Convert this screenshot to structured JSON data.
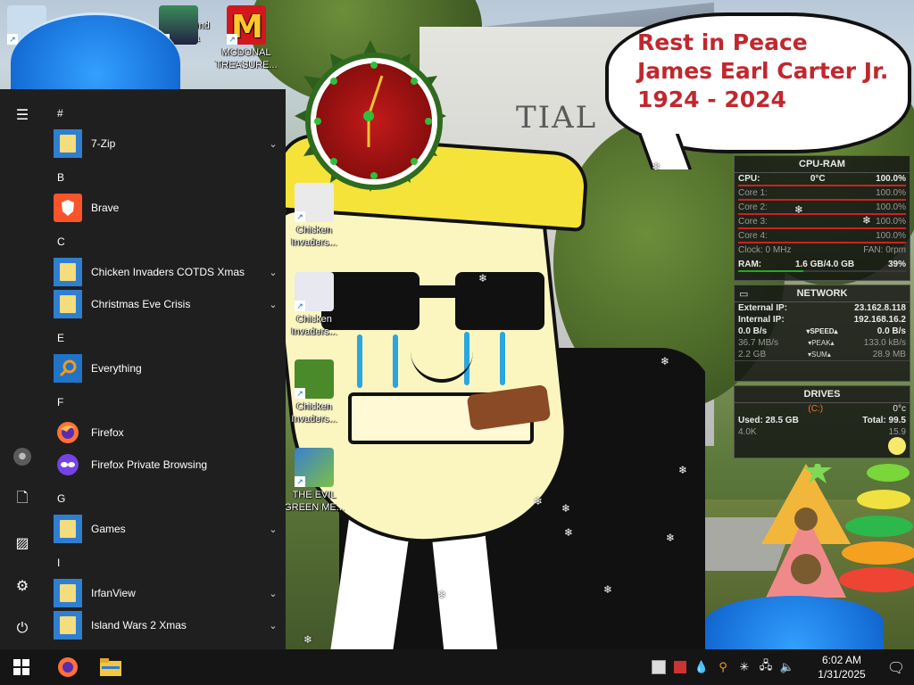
{
  "speech_bubble": {
    "line1": "Rest in Peace",
    "line2": "James Earl Carter Jr.",
    "line3": "1924 - 2024"
  },
  "wallpaper": {
    "building_text": "TIAL"
  },
  "desktop_icons": {
    "top_legend": "Legend\nilda",
    "mcdonald": "MCDONAL\nTREASURE...",
    "chicken1": "Chicken\nInvaders...",
    "chicken2": "Chicken\nInvaders...",
    "chicken3": "Chicken\nInvaders...",
    "evil": "THE EVIL\nGREEN ME..."
  },
  "start_menu": {
    "groups": [
      {
        "letter": "#",
        "items": [
          {
            "label": "7-Zip",
            "icon": "folder-icon",
            "expand": true
          }
        ]
      },
      {
        "letter": "B",
        "items": [
          {
            "label": "Brave",
            "icon": "brave-icon",
            "expand": false
          }
        ]
      },
      {
        "letter": "C",
        "items": [
          {
            "label": "Chicken Invaders COTDS Xmas",
            "icon": "folder-icon",
            "expand": true
          },
          {
            "label": "Christmas Eve Crisis",
            "icon": "folder-icon",
            "expand": true
          }
        ]
      },
      {
        "letter": "E",
        "items": [
          {
            "label": "Everything",
            "icon": "everything-icon",
            "expand": false
          }
        ]
      },
      {
        "letter": "F",
        "items": [
          {
            "label": "Firefox",
            "icon": "firefox-icon",
            "expand": false
          },
          {
            "label": "Firefox Private Browsing",
            "icon": "firefox-private-icon",
            "expand": false
          }
        ]
      },
      {
        "letter": "G",
        "items": [
          {
            "label": "Games",
            "icon": "folder-icon",
            "expand": true
          }
        ]
      },
      {
        "letter": "I",
        "items": [
          {
            "label": "IrfanView",
            "icon": "folder-icon",
            "expand": true
          },
          {
            "label": "Island Wars 2 Xmas",
            "icon": "folder-icon",
            "expand": true
          }
        ]
      }
    ],
    "chevron": "⌄",
    "rail": {
      "menu": "☰",
      "user": "●",
      "documents": "🗋",
      "pictures": "▨",
      "settings": "⚙",
      "power": "⏻"
    }
  },
  "monitor": {
    "cpu_ram": {
      "title": "CPU-RAM",
      "cpu_label": "CPU:",
      "cpu_temp": "0°C",
      "cpu_pct": "100.0%",
      "cores": [
        {
          "label": "Core 1:",
          "value": "100.0%"
        },
        {
          "label": "Core 2:",
          "value": "100.0%"
        },
        {
          "label": "Core 3:",
          "value": "100.0%"
        },
        {
          "label": "Core 4:",
          "value": "100.0%"
        }
      ],
      "clock": "Clock: 0 MHz",
      "fan": "FAN: 0rpm",
      "ram_label": "RAM:",
      "ram_value": "1.6 GB/4.0 GB",
      "ram_pct": "39%",
      "ram_fraction": 0.39,
      "core_fraction": 1.0
    },
    "network": {
      "title": "NETWORK",
      "external_label": "External IP:",
      "external_ip": "23.162.8.118",
      "internal_label": "Internal IP:",
      "internal_ip": "192.168.16.2",
      "speed_down": "0.0 B/s",
      "speed_label": "▾SPEED▴",
      "speed_up": "0.0 B/s",
      "peak_down": "36.7 MB/s",
      "peak_label": "▾PEAK▴",
      "peak_up": "133.0 kB/s",
      "sum_down": "2.2 GB",
      "sum_label": "▾SUM▴",
      "sum_up": "28.9 MB"
    },
    "drives": {
      "title": "DRIVES",
      "drive_label": "(C:)",
      "temp": "0°c",
      "used": "Used: 28.5 GB",
      "total": "Total: 99.5",
      "read": "4.0K",
      "write": "15.9"
    }
  },
  "taskbar": {
    "time": "6:02 AM",
    "date": "1/31/2025",
    "colors": {
      "bg": "#151515",
      "accent": "#0078d7"
    }
  }
}
